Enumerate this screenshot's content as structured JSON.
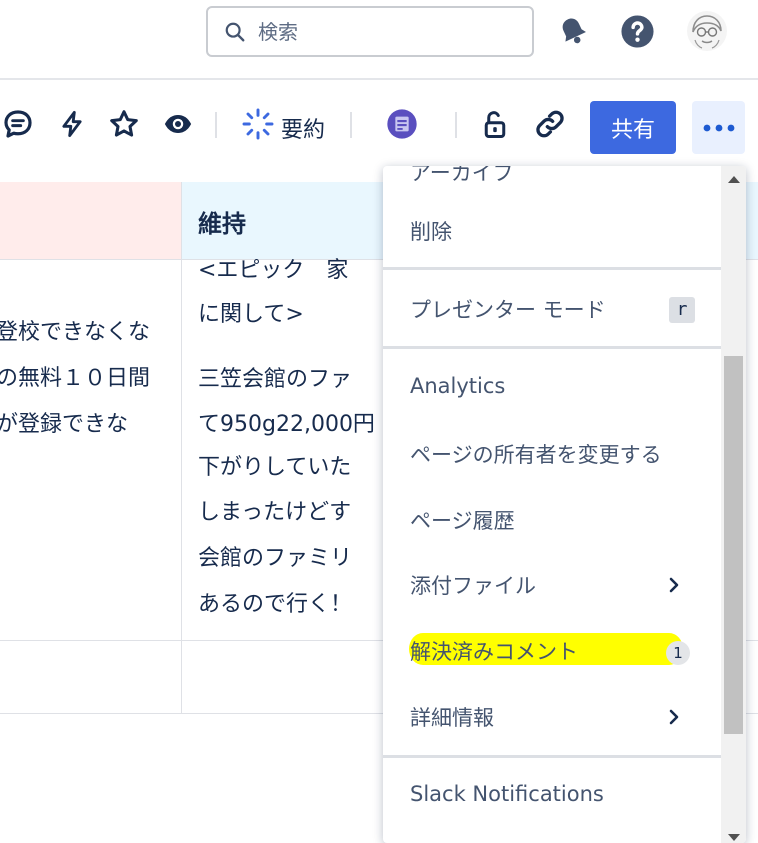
{
  "header": {
    "search_placeholder": "検索"
  },
  "toolbar": {
    "summary_label": "要約",
    "share_label": "共有"
  },
  "table": {
    "header_right": "維持",
    "left_lines": [
      "登校できなくな",
      "の無料１０日間",
      "が登録できな"
    ],
    "right_lines_top": [
      "<エピック　家",
      "に関して>"
    ],
    "right_lines_body": [
      "三笠会館のファ",
      "て950g22,000円",
      "下がりしていた",
      "しまったけどす",
      "会館のファミリ",
      "あるので行く！"
    ]
  },
  "menu": {
    "partial_top": "アーカイブ",
    "items": {
      "delete": "削除",
      "presenter": "プレゼンター モード",
      "presenter_shortcut": "r",
      "analytics": "Analytics",
      "change_owner": "ページの所有者を変更する",
      "history": "ページ履歴",
      "attachments": "添付ファイル",
      "resolved_comments": "解決済みコメント",
      "resolved_count": "1",
      "details": "詳細情報",
      "slack": "Slack Notifications"
    }
  },
  "colors": {
    "primary": "#3d69e0",
    "highlight": "#ffff00",
    "header_pink": "#ffeceb",
    "header_blue": "#e9f7fe"
  }
}
